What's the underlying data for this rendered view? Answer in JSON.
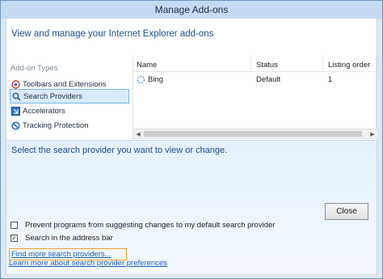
{
  "window": {
    "title": "Manage Add-ons"
  },
  "header": {
    "text": "View and manage your Internet Explorer add-ons"
  },
  "sidebar": {
    "label": "Add-on Types",
    "items": [
      {
        "label": "Toolbars and Extensions",
        "icon": "toolbars-extensions-icon",
        "selected": false
      },
      {
        "label": "Search Providers",
        "icon": "search-icon",
        "selected": true
      },
      {
        "label": "Accelerators",
        "icon": "accelerators-icon",
        "selected": false
      },
      {
        "label": "Tracking Protection",
        "icon": "tracking-protection-icon",
        "selected": false
      }
    ]
  },
  "list": {
    "columns": [
      "Name",
      "Status",
      "Listing order"
    ],
    "rows": [
      {
        "name": "Bing",
        "status": "Default",
        "order": "1"
      }
    ]
  },
  "detail": {
    "text": "Select the search provider you want to view or change.",
    "checkboxes": [
      {
        "label": "Prevent programs from suggesting changes to my default search provider",
        "checked": false
      },
      {
        "label": "Search in the address bar",
        "checked": true
      }
    ],
    "links": [
      "Find more search providers...",
      "Learn more about search provider preferences"
    ],
    "close_label": "Close"
  }
}
